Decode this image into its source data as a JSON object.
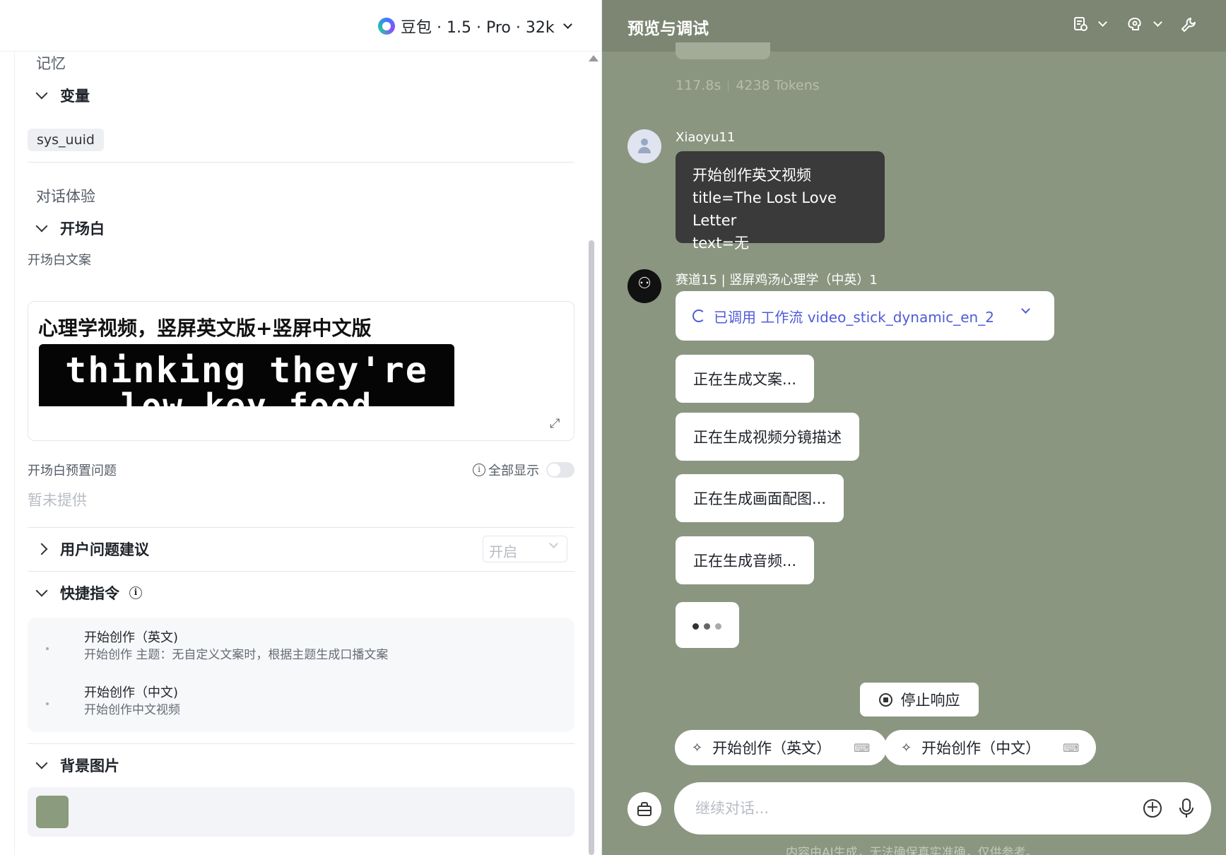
{
  "left": {
    "model": "豆包 · 1.5 · Pro · 32k",
    "memory_title": "记忆",
    "variables_label": "变量",
    "variable_tag": "sys_uuid",
    "dialog_title": "对话体验",
    "opening_label": "开场白",
    "opening_copy_label": "开场白文案",
    "opening_heading": "心理学视频，竖屏英文版+竖屏中文版",
    "opening_image_line1": "thinking they're",
    "opening_image_line2": "low key food",
    "preset_label": "开场白预置问题",
    "show_all_label": "全部显示",
    "preset_empty": "暂未提供",
    "user_suggest_label": "用户问题建议",
    "user_suggest_value": "开启",
    "shortcut_label": "快捷指令",
    "shortcuts": [
      {
        "name": "开始创作（英文)",
        "desc": "开始创作 主题：无自定义文案时，根据主题生成口播文案"
      },
      {
        "name": "开始创作（中文)",
        "desc": "开始创作中文视频"
      }
    ],
    "background_label": "背景图片"
  },
  "right": {
    "title": "预览与调试",
    "meta_time": "117.8s",
    "meta_tokens": "4238 Tokens",
    "user_name": "Xiaoyu11",
    "user_message_lines": [
      "开始创作英文视频",
      "title=The Lost Love Letter",
      "text=无"
    ],
    "bot_name": "赛道15 | 竖屏鸡汤心理学（中英）1",
    "tool_call": "已调用 工作流 video_stick_dynamic_en_2",
    "status_messages": [
      "正在生成文案...",
      "正在生成视频分镜描述",
      "正在生成画面配图...",
      "正在生成音频..."
    ],
    "stop_label": "停止响应",
    "chips": [
      "开始创作（英文）",
      "开始创作（中文）"
    ],
    "input_placeholder": "继续对话...",
    "footer": "内容由AI生成，无法确保真实准确，仅供参考。"
  },
  "colors": {
    "chat_bg": "#8a9680",
    "header_bg": "#7c8672",
    "accent": "#4e5bd8",
    "user_bubble": "#3a3a3a"
  }
}
